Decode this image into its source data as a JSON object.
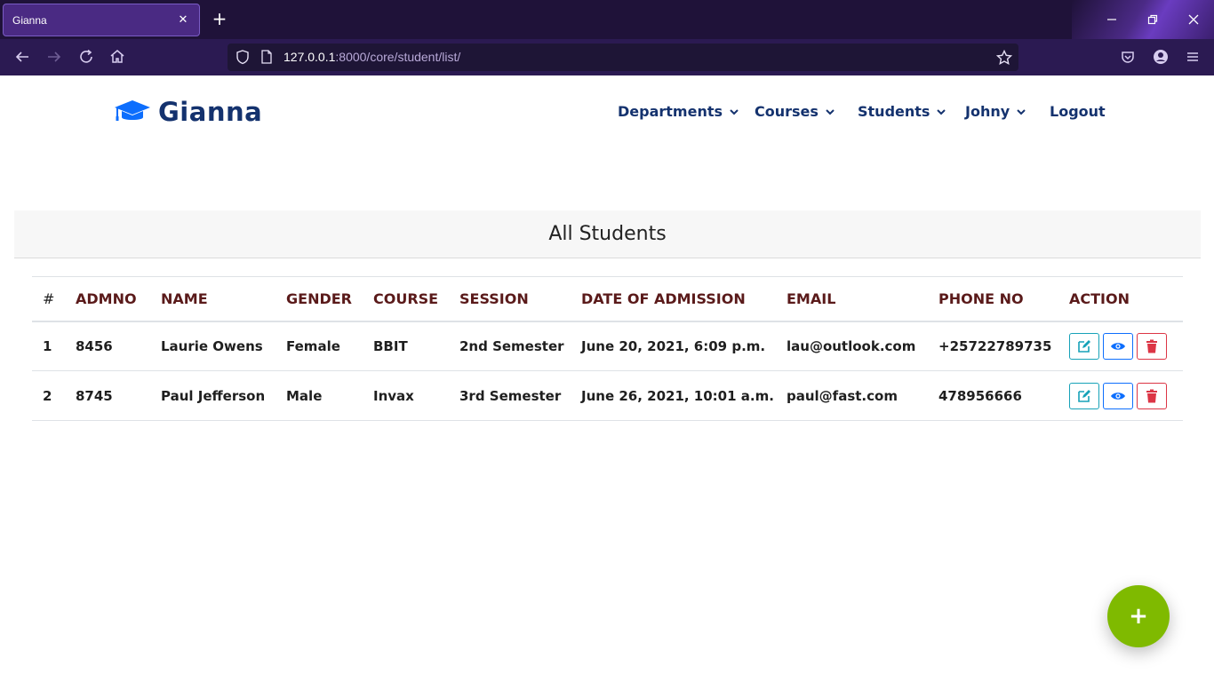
{
  "browser": {
    "tab_title": "Gianna",
    "tab_close": "✕",
    "new_tab": "+",
    "url_host": "127.0.0.1",
    "url_rest": ":8000/core/student/list/"
  },
  "site": {
    "brand": "Gianna",
    "nav": [
      {
        "label": "Departments"
      },
      {
        "label": "Courses"
      },
      {
        "label": "Students"
      },
      {
        "label": "Johny"
      },
      {
        "label": "Logout"
      }
    ]
  },
  "card": {
    "title": "All Students"
  },
  "table": {
    "headers": [
      "#",
      "ADMNO",
      "NAME",
      "GENDER",
      "COURSE",
      "SESSION",
      "DATE OF ADMISSION",
      "EMAIL",
      "PHONE NO",
      "ACTION"
    ],
    "rows": [
      [
        "1",
        "8456",
        "Laurie Owens",
        "Female",
        "BBIT",
        "2nd Semester",
        "June 20, 2021, 6:09 p.m.",
        "lau@outlook.com",
        "+25722789735"
      ],
      [
        "2",
        "8745",
        "Paul Jefferson",
        "Male",
        "Invax",
        "3rd Semester",
        "June 26, 2021, 10:01 a.m.",
        "paul@fast.com",
        "478956666"
      ]
    ]
  },
  "fab": {
    "label": "+"
  },
  "colors": {
    "brand": "#14326e",
    "fab": "#7fba00",
    "edit": "#17a2b8",
    "view": "#0d6efd",
    "delete": "#dc3545"
  }
}
